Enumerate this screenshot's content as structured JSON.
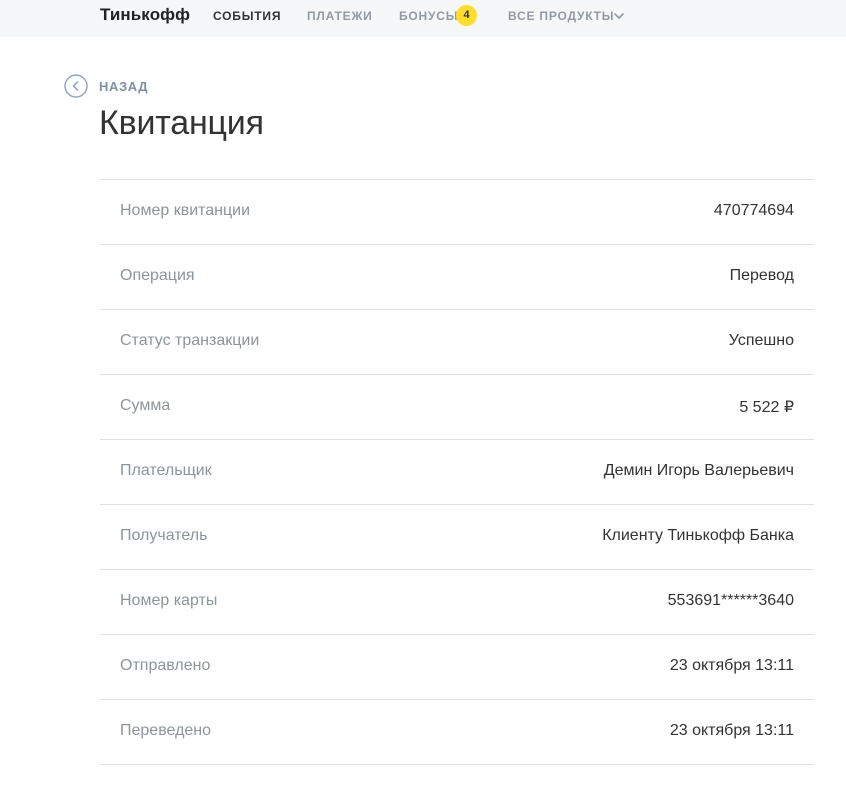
{
  "header": {
    "logo": "Тинькофф",
    "nav": [
      {
        "label": "СОБЫТИЯ"
      },
      {
        "label": "ПЛАТЕЖИ"
      },
      {
        "label": "БОНУСЫ"
      },
      {
        "label": "ВСЕ ПРОДУКТЫ"
      }
    ],
    "bonus_count": "4"
  },
  "back": {
    "label": "НАЗАД"
  },
  "page": {
    "title": "Квитанция"
  },
  "receipt": {
    "rows": [
      {
        "label": "Номер квитанции",
        "value": "470774694"
      },
      {
        "label": "Операция",
        "value": "Перевод"
      },
      {
        "label": "Статус транзакции",
        "value": "Успешно"
      },
      {
        "label": "Сумма",
        "value": "5 522 ₽"
      },
      {
        "label": "Плательщик",
        "value": "Демин Игорь Валерьевич"
      },
      {
        "label": "Получатель",
        "value": "Клиенту Тинькофф Банка"
      },
      {
        "label": "Номер карты",
        "value": "553691******3640"
      },
      {
        "label": "Отправлено",
        "value": "23 октября 13:11"
      },
      {
        "label": "Переведено",
        "value": "23 октября 13:11"
      }
    ]
  },
  "colors": {
    "accent_yellow": "#ffdd2d",
    "back_link": "#7f8fa8",
    "label_gray": "#8d949c",
    "divider": "#dddfe0"
  },
  "icons": {
    "back": "chevron-left-circle-icon",
    "products_dropdown": "chevron-down-icon"
  }
}
